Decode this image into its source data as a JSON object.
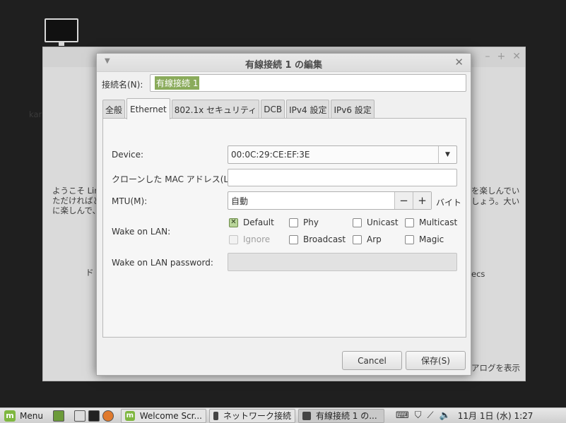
{
  "background_window": {
    "side_label": "kar",
    "intro_line1": "ようこそ Linu",
    "intro_line2": "ただければど",
    "intro_line3": "に楽しんで、",
    "right_line1": "を楽しんでい",
    "right_line2": "しょう。大い",
    "mid_left": "ド",
    "mid_right": "ecs",
    "bottom_right": "アログを表示"
  },
  "dialog": {
    "title": "有線接続 1 の編集",
    "connection_name_label": "接続名(N):",
    "connection_name_value": "有線接続 1",
    "tabs": [
      "全般",
      "Ethernet",
      "802.1x セキュリティ",
      "DCB",
      "IPv4 設定",
      "IPv6 設定"
    ],
    "active_tab": "Ethernet",
    "ethernet": {
      "device_label": "Device:",
      "device_value": "00:0C:29:CE:EF:3E",
      "clone_mac_label": "クローンした MAC アドレス(L):",
      "clone_mac_value": "",
      "mtu_label": "MTU(M):",
      "mtu_value": "自動",
      "mtu_unit": "バイト",
      "wol_label": "Wake on LAN:",
      "wol_options": [
        {
          "label": "Default",
          "checked": true,
          "disabled": false
        },
        {
          "label": "Phy",
          "checked": false,
          "disabled": false
        },
        {
          "label": "Unicast",
          "checked": false,
          "disabled": false
        },
        {
          "label": "Multicast",
          "checked": false,
          "disabled": false
        },
        {
          "label": "Ignore",
          "checked": false,
          "disabled": true
        },
        {
          "label": "Broadcast",
          "checked": false,
          "disabled": false
        },
        {
          "label": "Arp",
          "checked": false,
          "disabled": false
        },
        {
          "label": "Magic",
          "checked": false,
          "disabled": false
        }
      ],
      "wol_password_label": "Wake on LAN password:",
      "wol_password_value": ""
    },
    "cancel_label": "Cancel",
    "save_label": "保存(S)"
  },
  "panel": {
    "menu_label": "Menu",
    "tasks": [
      {
        "label": "Welcome Scr...",
        "active": false
      },
      {
        "label": "ネットワーク接続",
        "active": false
      },
      {
        "label": "有線接続 1 の...",
        "active": true
      }
    ],
    "clock": "11月 1日 (水)  1:27"
  },
  "colors": {
    "accent_green": "#8aab5b",
    "mint_green": "#7fb740"
  }
}
